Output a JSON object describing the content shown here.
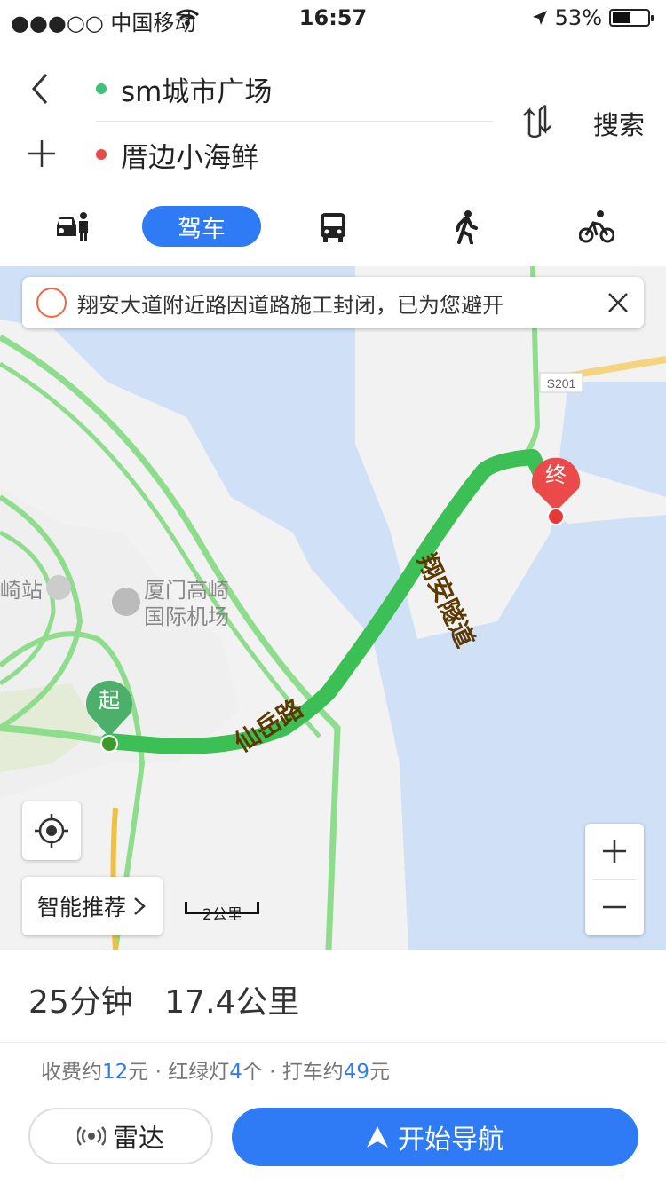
{
  "status": {
    "carrier": "●●●○○ 中国移动",
    "time": "16:57",
    "battery": "53%",
    "battery_level": 0.53
  },
  "route": {
    "from": "sm城市广场",
    "to": "厝边小海鲜",
    "search_label": "搜索"
  },
  "tabs": {
    "active_label": "驾车",
    "items": [
      "car-icon",
      "bus-icon",
      "walk-icon",
      "bike-icon"
    ]
  },
  "map": {
    "notice": "翔安大道附近路因道路施工封闭，已为您避开",
    "start_marker": "起",
    "end_marker": "终",
    "labels": {
      "airport": "厦门高崎",
      "airport2": "国际机场",
      "station": "崎站",
      "road1": "翔安隧道",
      "road2": "仙岳路",
      "highway": "S201"
    },
    "smart_label": "智能推荐",
    "scale_label": "2公里"
  },
  "summary": {
    "time": "25分钟",
    "distance": "17.4公里"
  },
  "details": {
    "toll_prefix": "收费约",
    "toll": "12",
    "toll_suffix": "元 · 红绿灯",
    "lights": "4",
    "lights_suffix": "个 · 打车约",
    "taxi": "49",
    "taxi_suffix": "元"
  },
  "buttons": {
    "radar": "雷达",
    "navigate": "开始导航"
  },
  "colors": {
    "accent": "#2f7bf5",
    "route": "#3cc27a",
    "end": "#e84b4b"
  }
}
